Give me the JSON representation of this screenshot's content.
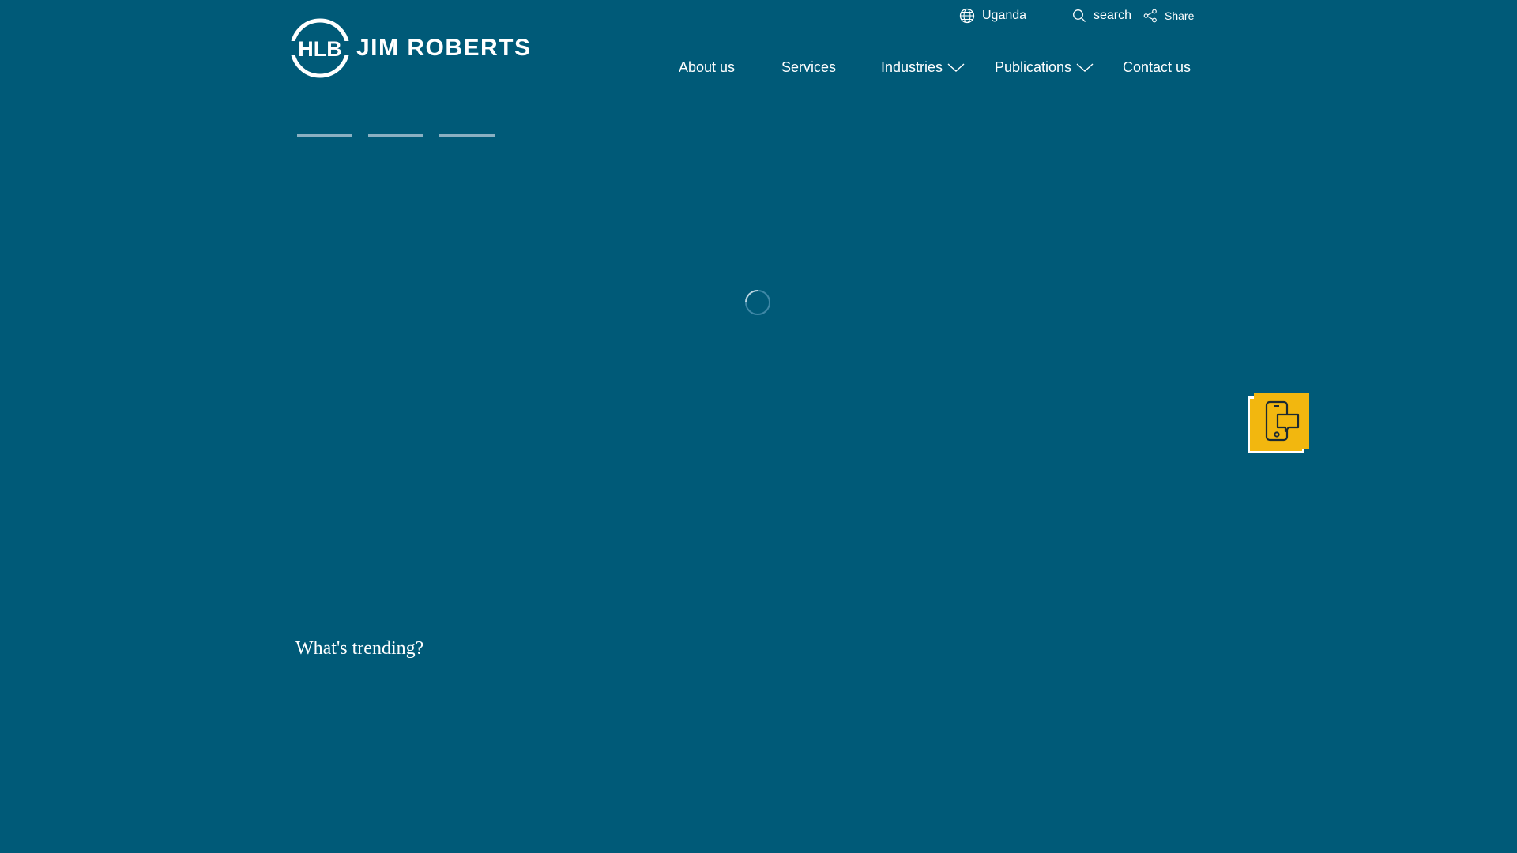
{
  "header": {
    "logo_mark": "HLB",
    "logo_name": "JIM ROBERTS",
    "country_label": "Uganda",
    "search_label": "search",
    "share_label": "Share"
  },
  "nav": {
    "items": [
      {
        "label": "About us",
        "has_dropdown": false
      },
      {
        "label": "Services",
        "has_dropdown": false
      },
      {
        "label": "Industries",
        "has_dropdown": true
      },
      {
        "label": "Publications",
        "has_dropdown": true
      },
      {
        "label": "Contact us",
        "has_dropdown": false
      }
    ]
  },
  "hero": {
    "slide_count": 3,
    "loading": true
  },
  "trending": {
    "heading": "What's trending?"
  },
  "colors": {
    "background": "#005a78",
    "accent": "#f2b70f",
    "text": "#ffffff",
    "slider_indicator": "#8ab0c2"
  },
  "icons": {
    "country": "globe-icon",
    "search": "search-icon",
    "share": "share-icon",
    "dropdown": "chevron-down-icon",
    "float_button": "phone-chat-icon",
    "loading": "spinner-icon"
  }
}
